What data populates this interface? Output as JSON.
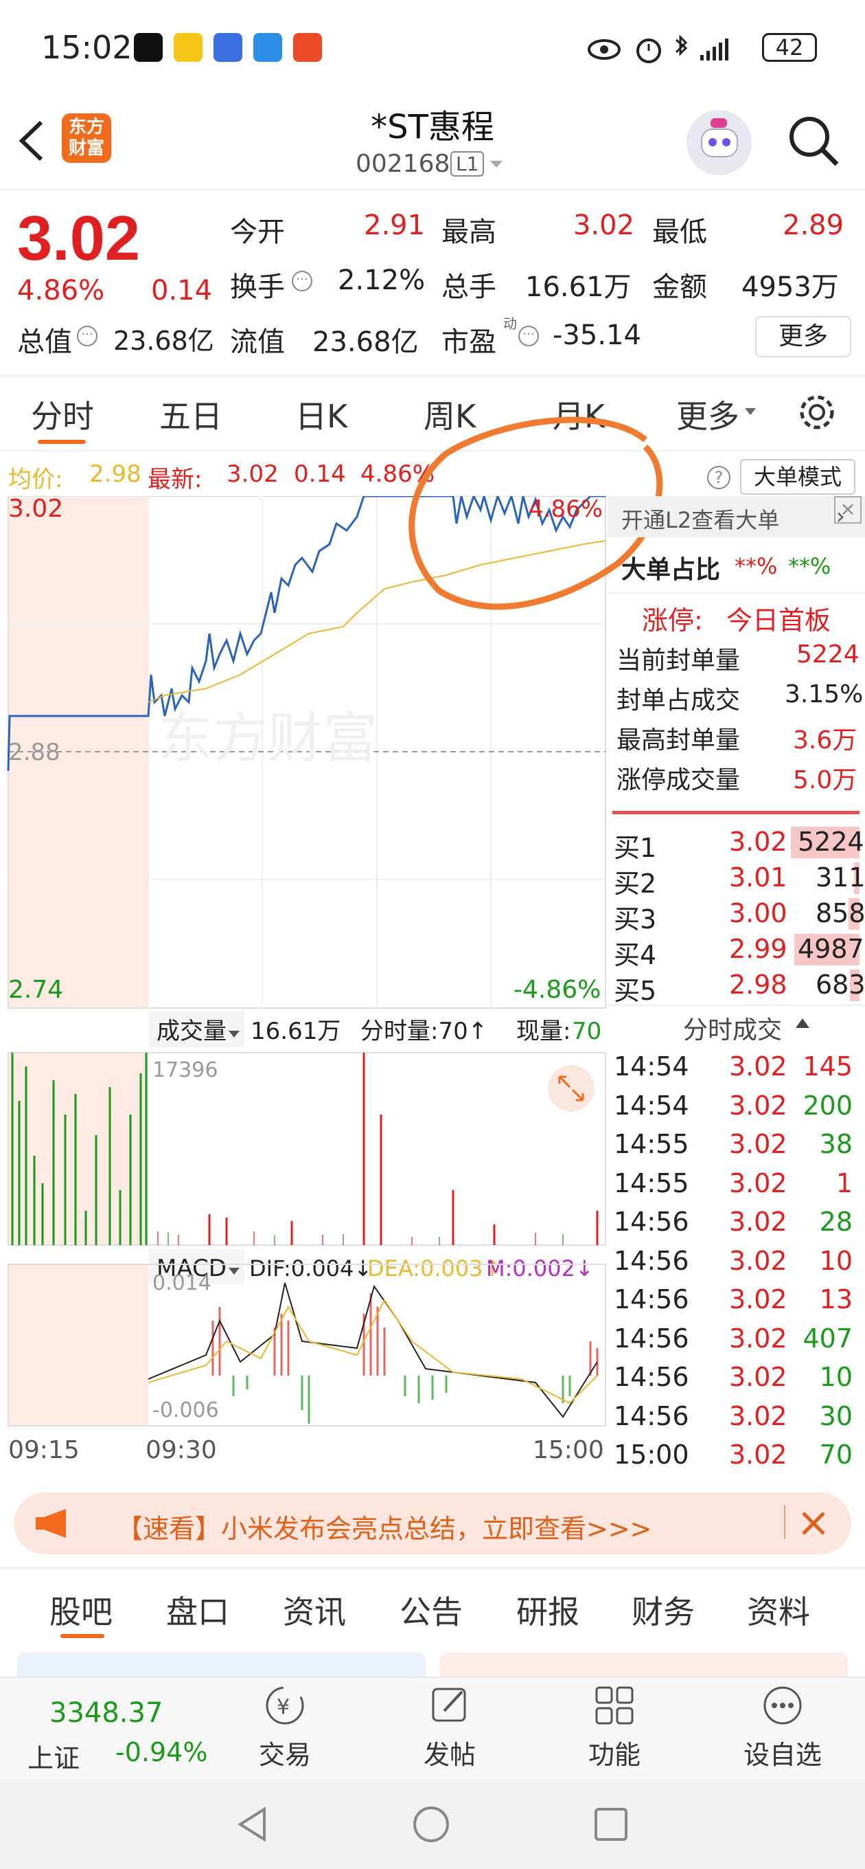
{
  "status_bar": {
    "time": "15:02",
    "battery": "42"
  },
  "header": {
    "back_icon": "chevron-left-icon",
    "logo_text": "东方\n财富",
    "title": "*ST惠程",
    "code": "002168",
    "level_badge": "L1"
  },
  "quote": {
    "price": "3.02",
    "change_pct": "4.86%",
    "change": "0.14",
    "open_label": "今开",
    "open": "2.91",
    "high_label": "最高",
    "high": "3.02",
    "low_label": "最低",
    "low": "2.89",
    "turnover_label": "换手",
    "turnover": "2.12%",
    "volume_label": "总手",
    "volume": "16.61万",
    "amount_label": "金额",
    "amount": "4953万",
    "mktcap_label": "总值",
    "mktcap": "23.68亿",
    "float_label": "流值",
    "float": "23.68亿",
    "pe_label": "市盈",
    "pe_sup": "动",
    "pe": "-35.14",
    "more_button": "更多"
  },
  "tabs": [
    "分时",
    "五日",
    "日K",
    "周K",
    "月K",
    "更多"
  ],
  "chart_header": {
    "avg_label": "均价:",
    "avg": "2.98",
    "latest_label": "最新:",
    "latest": "3.02",
    "latest_change": "0.14",
    "latest_pct": "4.86%",
    "big_order_mode": "大单模式"
  },
  "chart_labels": {
    "y_top": "3.02",
    "y_mid": "2.88",
    "y_bottom": "2.74",
    "pct_top": "4.86%",
    "pct_bottom": "-4.86%",
    "watermark": "东方财富"
  },
  "volume_panel": {
    "label": "成交量",
    "total": "16.61万",
    "minute_label": "分时量:70↑",
    "current_label": "现量:",
    "current": "70",
    "max": "17396"
  },
  "macd_panel": {
    "label": "MACD",
    "dif": "DIF:0.004↓",
    "dea": "DEA:0.003↑",
    "m": "M:0.002↓",
    "top": "0.014",
    "bottom": "-0.006"
  },
  "time_axis": [
    "09:15",
    "09:30",
    "15:00"
  ],
  "side_panel": {
    "l2_banner": "开通L2查看大单",
    "big_ratio_label": "大单占比",
    "big_ratio_a": "**%",
    "big_ratio_b": "**%",
    "limit_up_label": "涨停:",
    "limit_up_value": "今日首板",
    "stats": [
      {
        "label": "当前封单量",
        "value": "5224"
      },
      {
        "label": "封单占成交",
        "value": "3.15%"
      },
      {
        "label": "最高封单量",
        "value": "3.6万"
      },
      {
        "label": "涨停成交量",
        "value": "5.0万"
      }
    ],
    "order_book": [
      {
        "label": "买1",
        "price": "3.02",
        "qty": "5224"
      },
      {
        "label": "买2",
        "price": "3.01",
        "qty": "311"
      },
      {
        "label": "买3",
        "price": "3.00",
        "qty": "858"
      },
      {
        "label": "买4",
        "price": "2.99",
        "qty": "4987"
      },
      {
        "label": "买5",
        "price": "2.98",
        "qty": "683"
      }
    ],
    "trades_title": "分时成交",
    "trades": [
      {
        "time": "14:54",
        "price": "3.02",
        "vol": "145",
        "color": "#e02020"
      },
      {
        "time": "14:54",
        "price": "3.02",
        "vol": "200",
        "color": "#1a9a1a"
      },
      {
        "time": "14:55",
        "price": "3.02",
        "vol": "38",
        "color": "#1a9a1a"
      },
      {
        "time": "14:55",
        "price": "3.02",
        "vol": "1",
        "color": "#e02020"
      },
      {
        "time": "14:56",
        "price": "3.02",
        "vol": "28",
        "color": "#1a9a1a"
      },
      {
        "time": "14:56",
        "price": "3.02",
        "vol": "10",
        "color": "#e02020"
      },
      {
        "time": "14:56",
        "price": "3.02",
        "vol": "13",
        "color": "#e02020"
      },
      {
        "time": "14:56",
        "price": "3.02",
        "vol": "407",
        "color": "#1a9a1a"
      },
      {
        "time": "14:56",
        "price": "3.02",
        "vol": "10",
        "color": "#1a9a1a"
      },
      {
        "time": "14:56",
        "price": "3.02",
        "vol": "30",
        "color": "#1a9a1a"
      },
      {
        "time": "15:00",
        "price": "3.02",
        "vol": "70",
        "color": "#1a9a1a"
      }
    ]
  },
  "ad_banner": {
    "text": "【速看】小米发布会亮点总结，立即查看>>>"
  },
  "bottom_tabs": [
    "股吧",
    "盘口",
    "资讯",
    "公告",
    "研报",
    "财务",
    "资料"
  ],
  "bottom_nav": {
    "index_value": "3348.37",
    "index_name": "上证",
    "index_change": "-0.94%",
    "items": [
      {
        "label": "交易",
        "icon": "trade-icon"
      },
      {
        "label": "发帖",
        "icon": "edit-icon"
      },
      {
        "label": "功能",
        "icon": "grid-icon"
      },
      {
        "label": "设自选",
        "icon": "more-icon"
      }
    ]
  },
  "colors": {
    "up": "#e02020",
    "down": "#1a9a1a",
    "accent": "#f26a1b",
    "price_line": "#2a63b8",
    "avg_line": "#e8b830"
  },
  "chart_data": {
    "type": "line",
    "title": "",
    "series": [
      {
        "name": "最新",
        "y_range": [
          2.74,
          3.02
        ]
      },
      {
        "name": "均价"
      }
    ],
    "ylim": [
      2.74,
      3.02
    ],
    "reference": 2.88,
    "latest": 3.02,
    "average": 2.98,
    "x": [
      "09:15",
      "09:30",
      "15:00"
    ]
  }
}
